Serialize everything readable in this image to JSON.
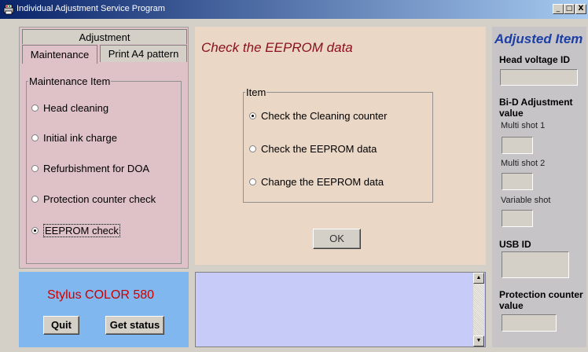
{
  "window": {
    "title": "Individual Adjustment Service Program",
    "minimize_glyph": "_",
    "maximize_glyph": "□",
    "close_glyph": "X"
  },
  "tabs": {
    "adjustment": "Adjustment",
    "maintenance": "Maintenance",
    "print_a4": "Print A4 pattern"
  },
  "maintenance_group": {
    "legend": "Maintenance Item",
    "items": [
      {
        "label": "Head cleaning",
        "selected": false
      },
      {
        "label": "Initial ink charge",
        "selected": false
      },
      {
        "label": "Refurbishment for DOA",
        "selected": false
      },
      {
        "label": "Protection counter check",
        "selected": false
      },
      {
        "label": "EEPROM check",
        "selected": true
      }
    ]
  },
  "center": {
    "title": "Check the EEPROM data",
    "item_group": {
      "legend": "Item",
      "options": [
        {
          "label": "Check the Cleaning counter",
          "selected": true
        },
        {
          "label": "Check the EEPROM data",
          "selected": false
        },
        {
          "label": "Change the EEPROM data",
          "selected": false
        }
      ]
    },
    "ok_label": "OK"
  },
  "printer": {
    "model": "Stylus COLOR 580",
    "quit_label": "Quit",
    "get_status_label": "Get status"
  },
  "scroll": {
    "up_glyph": "▲",
    "down_glyph": "▼"
  },
  "adjusted": {
    "title": "Adjusted Item",
    "head_voltage_label": "Head voltage ID",
    "bid_label_1": "Bi-D Adjustment",
    "bid_label_2": "value",
    "multi_shot_1": "Multi shot 1",
    "multi_shot_2": "Multi shot 2",
    "variable_shot": "Variable shot",
    "usb_id_label": "USB ID",
    "protection_label_1": "Protection counter",
    "protection_label_2": "value"
  },
  "colors": {
    "title_bar": "#0a246a",
    "maintenance_panel": "#dfc2c8",
    "center_panel": "#ead7c6",
    "model_panel": "#7fb7ee",
    "message_box": "#c7cbf7",
    "heading_red": "#8a0f1c",
    "heading_blue": "#1c3fa6",
    "model_red": "#cc0000"
  }
}
